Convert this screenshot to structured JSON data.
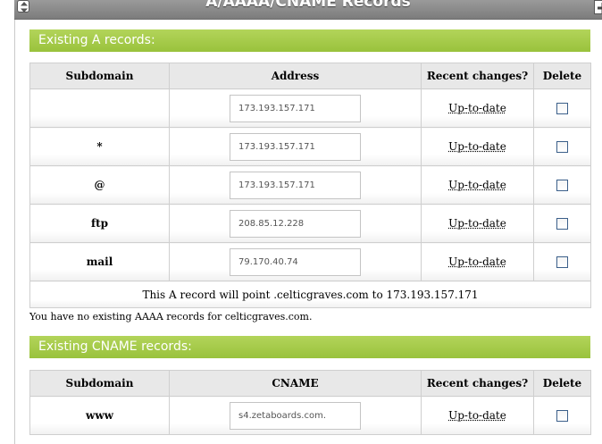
{
  "panel": {
    "title": "A/AAAA/CNAME Records"
  },
  "a_records": {
    "section_title": "Existing A records:",
    "columns": [
      "Subdomain",
      "Address",
      "Recent changes?",
      "Delete"
    ],
    "rows": [
      {
        "subdomain": "",
        "address": "173.193.157.171",
        "status": "Up-to-date",
        "delete": false
      },
      {
        "subdomain": "*",
        "address": "173.193.157.171",
        "status": "Up-to-date",
        "delete": false
      },
      {
        "subdomain": "@",
        "address": "173.193.157.171",
        "status": "Up-to-date",
        "delete": false
      },
      {
        "subdomain": "ftp",
        "address": "208.85.12.228",
        "status": "Up-to-date",
        "delete": false
      },
      {
        "subdomain": "mail",
        "address": "79.170.40.74",
        "status": "Up-to-date",
        "delete": false
      }
    ],
    "note": "This A record will point .celticgraves.com to 173.193.157.171"
  },
  "aaaa_records": {
    "message": "You have no existing AAAA records for celticgraves.com."
  },
  "cname_records": {
    "section_title": "Existing CNAME records:",
    "columns": [
      "Subdomain",
      "CNAME",
      "Recent changes?",
      "Delete"
    ],
    "rows": [
      {
        "subdomain": "www",
        "cname": "s4.zetaboards.com.",
        "status": "Up-to-date",
        "delete": false
      }
    ]
  },
  "colors": {
    "section_bar": "#a6ca48",
    "header_bar": "#8c8c8c"
  }
}
